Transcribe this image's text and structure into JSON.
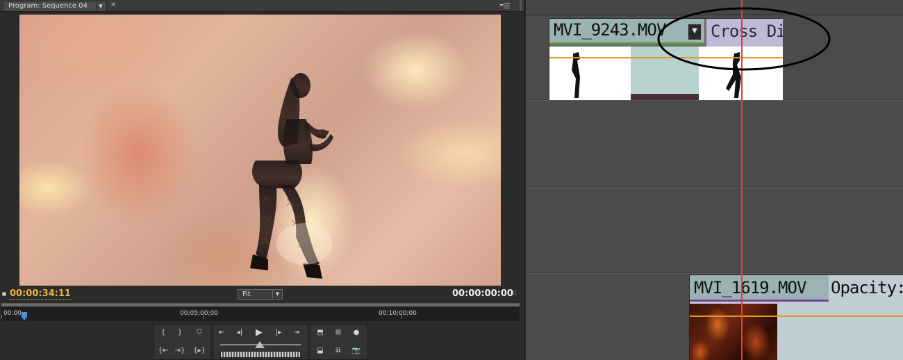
{
  "program_monitor": {
    "tab_title": "Program: Sequence 04",
    "current_timecode": "00:00:34:11",
    "zoom_select": "Fit",
    "duration_timecode": "00:00:00:00",
    "ruler": {
      "labels": [
        "00:00",
        "00;05;00;00",
        "00;10;00;00"
      ]
    }
  },
  "timeline": {
    "clip_top": {
      "name": "MVI_9243.MOV",
      "transition_label": "Cross Di"
    },
    "clip_bottom": {
      "name": "MVI_1619.MOV",
      "effect_label": "Opacity:("
    }
  },
  "colors": {
    "timecode_accent": "#e8b53a",
    "playhead": "#e0442a",
    "rubber_band": "#e39a25",
    "clip_header": "#9bb4b3",
    "transition": "#bfb9d8"
  }
}
